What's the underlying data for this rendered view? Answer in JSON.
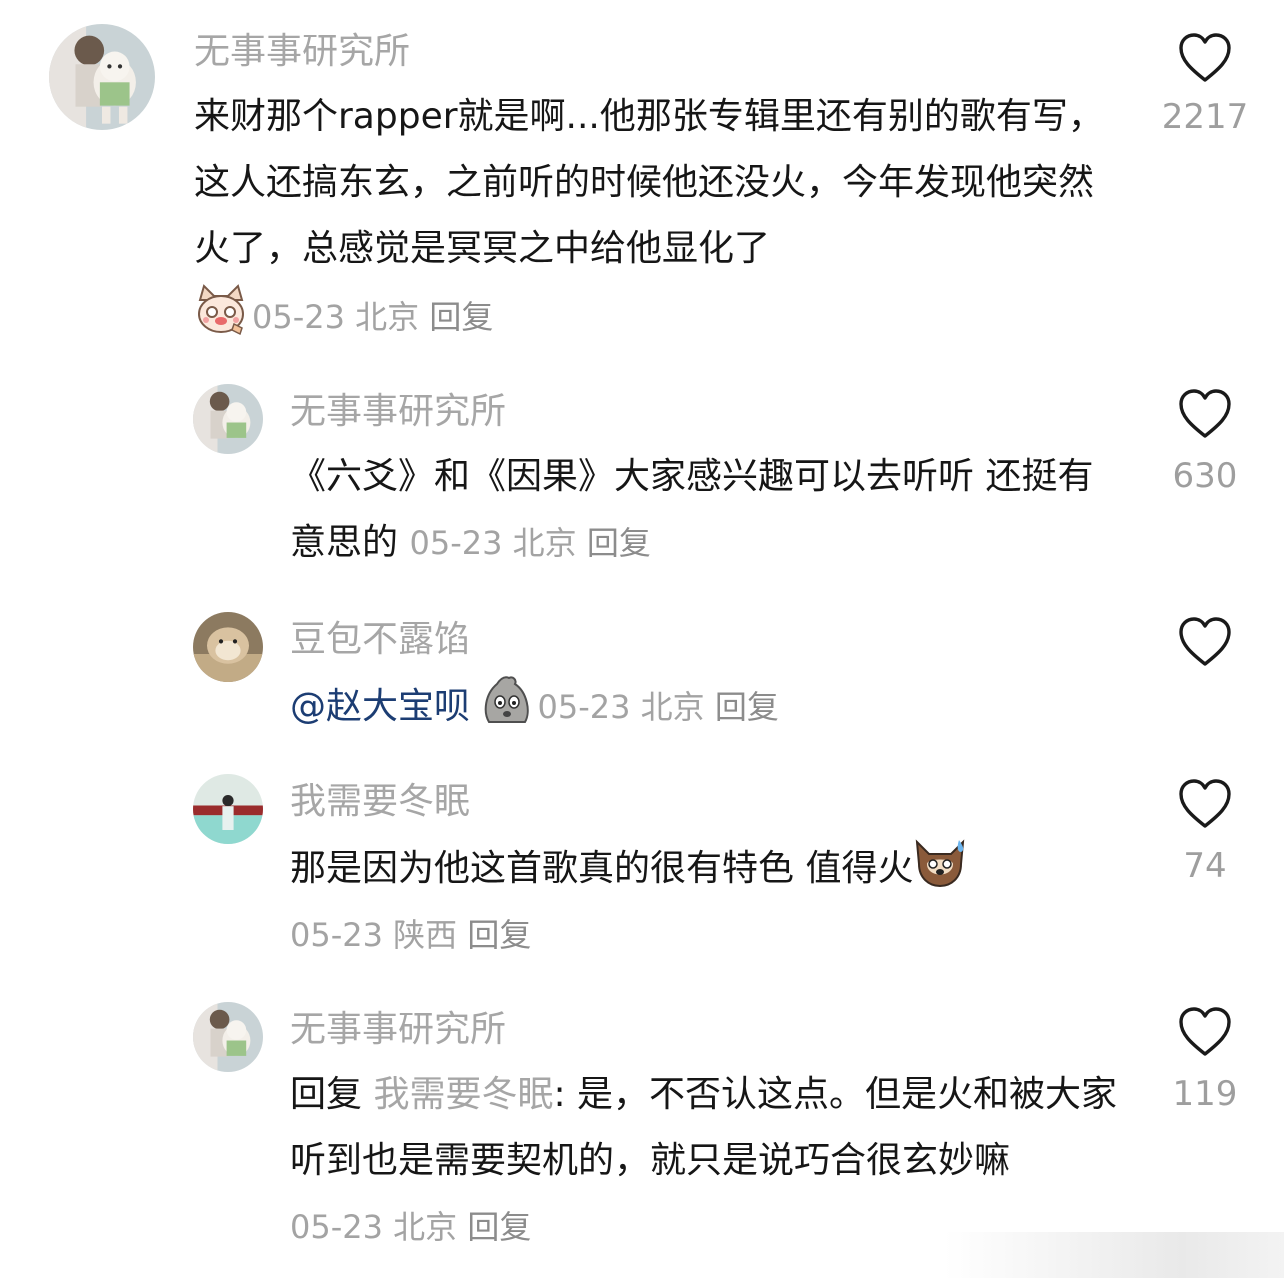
{
  "comments": [
    {
      "username": "无事事研究所",
      "text": "来财那个rapper就是啊...他那张专辑里还有别的歌有写，这人还搞东玄，之前听的时候他还没火，今年发现他突然火了，总感觉是冥冥之中给他显化了",
      "date": "05-23",
      "location": "北京",
      "reply_label": "回复",
      "likes": "2217",
      "emoji": "cat-blush-emoji"
    },
    {
      "username": "无事事研究所",
      "text": "《六爻》和《因果》大家感兴趣可以去听听 还挺有意思的",
      "date": "05-23",
      "location": "北京",
      "reply_label": "回复",
      "likes": "630"
    },
    {
      "username": "豆包不露馅",
      "mention": "@赵大宝呗",
      "date": "05-23",
      "location": "北京",
      "reply_label": "回复",
      "likes": "",
      "emoji": "sweating-bun-emoji"
    },
    {
      "username": "我需要冬眠",
      "text": "那是因为他这首歌真的很有特色 值得火",
      "date": "05-23",
      "location": "陕西",
      "reply_label": "回复",
      "likes": "74",
      "emoji": "dog-sweat-emoji"
    },
    {
      "username": "无事事研究所",
      "reply_prefix": "回复",
      "reply_to": "我需要冬眠",
      "text": ": 是，不否认这点。但是火和被大家听到也是需要契机的，就只是说巧合很玄妙嘛",
      "date": "05-23",
      "location": "北京",
      "reply_label": "回复",
      "likes": "119"
    }
  ],
  "colors": {
    "text": "#161616",
    "username": "#a6a6a6",
    "meta": "#a3a3a3",
    "mention": "#1c3d73",
    "likes": "#9e9e9e"
  }
}
